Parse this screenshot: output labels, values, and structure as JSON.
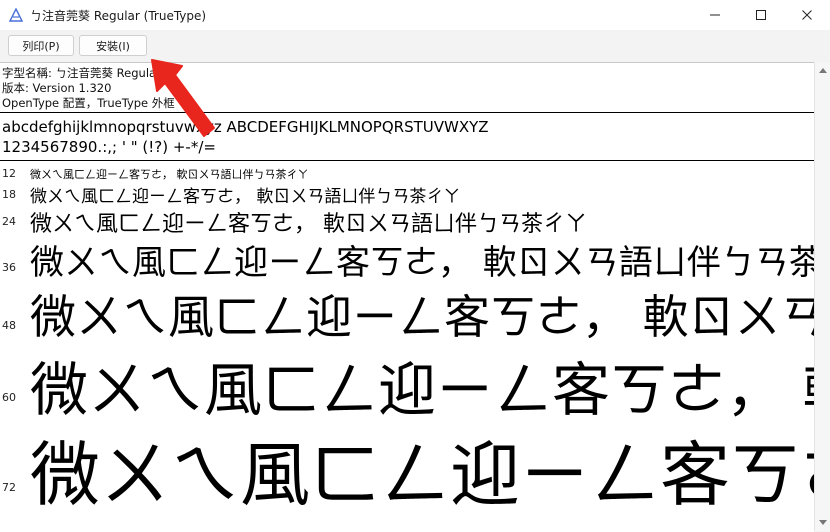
{
  "window": {
    "title": "ㄅ注音莞葵 Regular (TrueType)",
    "minimize_glyph": "—",
    "maximize_glyph": "☐",
    "close_glyph": "✕"
  },
  "toolbar": {
    "print_label": "列印(P)",
    "install_label": "安裝(I)"
  },
  "info": {
    "font_name": "字型名稱: ㄅ注音莞葵 Regular",
    "version": "版本: Version 1.320",
    "outline": "OpenType 配置，TrueType 外框"
  },
  "samples": {
    "lowercase_uppercase": "abcdefghijklmnopqrstuvwxyz ABCDEFGHIJKLMNOPQRSTUVWXYZ",
    "digits_symbols": "1234567890.:,; ' \" (!?) +-*/="
  },
  "preview_text": "微ㄨㄟ風ㄈㄥ迎ㄧㄥ客ㄎㄜ， 軟ㄖㄨㄢ語ㄩ伴ㄅㄢ茶ㄔㄚ",
  "previews": [
    {
      "size": "12"
    },
    {
      "size": "18"
    },
    {
      "size": "24"
    },
    {
      "size": "36"
    },
    {
      "size": "48"
    },
    {
      "size": "60"
    },
    {
      "size": "72"
    }
  ],
  "colors": {
    "annotation_arrow": "#e8261d"
  }
}
